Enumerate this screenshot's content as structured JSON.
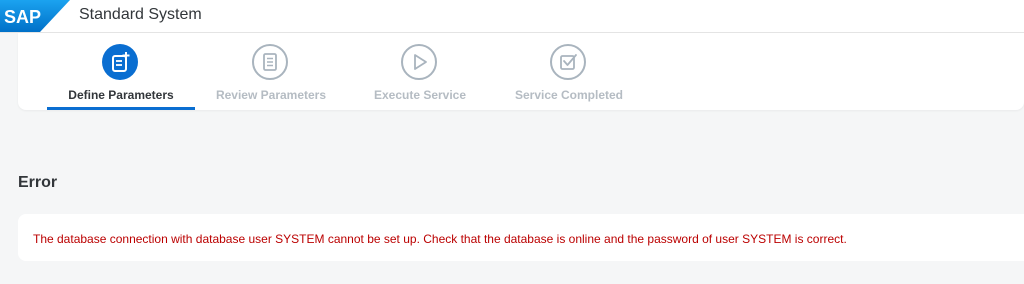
{
  "shell": {
    "logo_text": "SAP",
    "title": "Standard System"
  },
  "wizard": {
    "steps": [
      {
        "label": "Define Parameters",
        "icon": "define-parameters-icon",
        "state": "active"
      },
      {
        "label": "Review Parameters",
        "icon": "review-checklist-icon",
        "state": "inactive"
      },
      {
        "label": "Execute Service",
        "icon": "play-icon",
        "state": "inactive"
      },
      {
        "label": "Service Completed",
        "icon": "checkbox-completed-icon",
        "state": "inactive"
      }
    ]
  },
  "error": {
    "title": "Error",
    "message": "The database connection with database user SYSTEM cannot be set up. Check that the database is online and the password of user SYSTEM is correct."
  },
  "colors": {
    "accent": "#0a6ed1",
    "error_text": "#bb0000",
    "inactive_step": "#a9b4be",
    "background": "#f5f6f7"
  }
}
